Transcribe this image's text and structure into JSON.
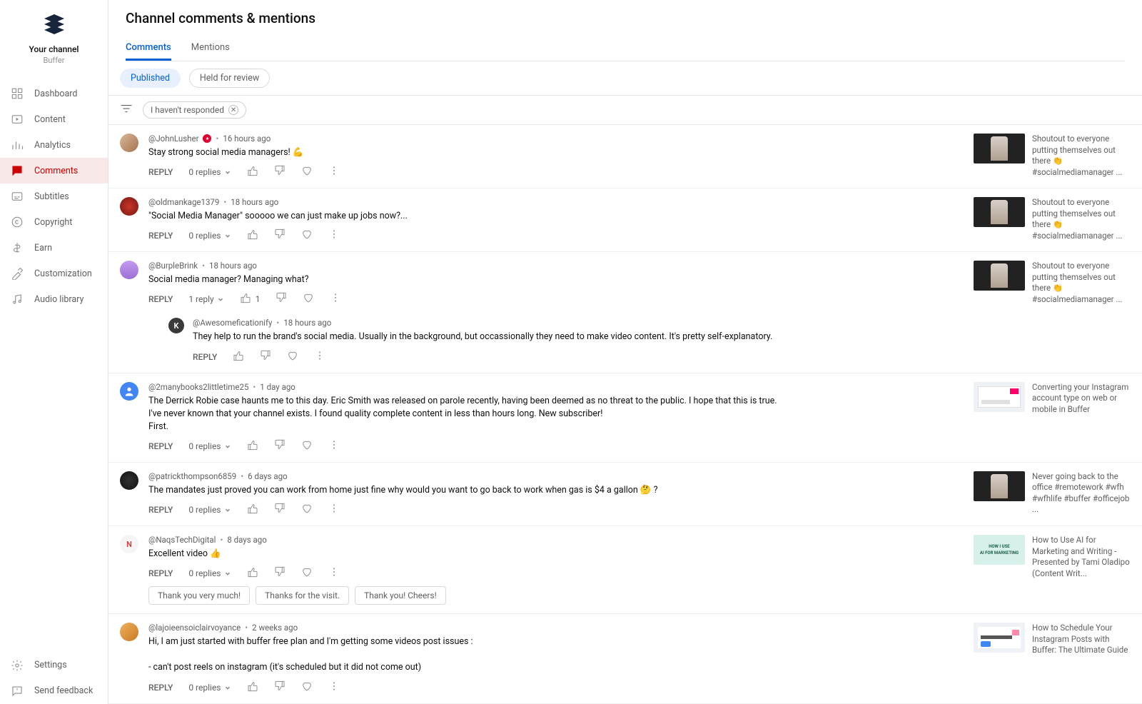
{
  "sidebar": {
    "channel_name": "Your channel",
    "channel_sub": "Buffer",
    "items": [
      {
        "label": "Dashboard",
        "icon": "dashboard"
      },
      {
        "label": "Content",
        "icon": "content"
      },
      {
        "label": "Analytics",
        "icon": "analytics"
      },
      {
        "label": "Comments",
        "icon": "comments",
        "active": true
      },
      {
        "label": "Subtitles",
        "icon": "subtitles"
      },
      {
        "label": "Copyright",
        "icon": "copyright"
      },
      {
        "label": "Earn",
        "icon": "earn"
      },
      {
        "label": "Customization",
        "icon": "customization"
      },
      {
        "label": "Audio library",
        "icon": "audio"
      }
    ],
    "footer": [
      {
        "label": "Settings",
        "icon": "settings"
      },
      {
        "label": "Send feedback",
        "icon": "feedback"
      }
    ]
  },
  "header": {
    "title": "Channel comments & mentions",
    "tabs": [
      {
        "label": "Comments",
        "active": true
      },
      {
        "label": "Mentions"
      }
    ],
    "subfilters": [
      {
        "label": "Published",
        "active": true
      },
      {
        "label": "Held for review"
      }
    ],
    "chip": "I haven't responded"
  },
  "comments": [
    {
      "user": "@JohnLusher",
      "badge": true,
      "time": "16 hours ago",
      "text": "Stay strong social media managers! 💪",
      "reply_label": "REPLY",
      "replies_text": "0 replies",
      "avatar_bg": "linear-gradient(135deg,#d8b89a,#a7734f)",
      "video": {
        "title": "Shoutout to everyone putting themselves out there 👏 #socialmediamanager ...",
        "thumb": "dark-person"
      }
    },
    {
      "user": "@oldmankage1379",
      "time": "18 hours ago",
      "text": "\"Social Media Manager\" sooooo we can just make up jobs now?...",
      "reply_label": "REPLY",
      "replies_text": "0 replies",
      "avatar_bg": "radial-gradient(#c73628,#7a1712)",
      "video": {
        "title": "Shoutout to everyone putting themselves out there 👏 #socialmediamanager ...",
        "thumb": "dark-person"
      }
    },
    {
      "user": "@BurpleBrink",
      "time": "18 hours ago",
      "text": "Social media manager? Managing what?",
      "reply_label": "REPLY",
      "replies_text": "1 reply",
      "like_count": "1",
      "avatar_bg": "linear-gradient(180deg,#c59bf0,#9b6fd6)",
      "video": {
        "title": "Shoutout to everyone putting themselves out there 👏 #socialmediamanager ...",
        "thumb": "dark-person"
      },
      "nested": {
        "user": "@Awesomeficationify",
        "time": "18 hours ago",
        "text": "They help to run the brand's social media. Usually in the background, but occassionally they need to make video content. It's pretty self-explanatory.",
        "reply_label": "REPLY",
        "avatar_bg": "#3a3a3a",
        "avatar_letter": "K"
      }
    },
    {
      "user": "@2manybooks2littletime25",
      "time": "1 day ago",
      "text": "The Derrick Robie case haunts me to this day. Eric Smith was released on parole recently, having been deemed as no threat to the public. I hope that this is true. I've never known that your channel exists. I found quality complete content in less than hours long. New subscriber!\nFirst.",
      "reply_label": "REPLY",
      "replies_text": "0 replies",
      "avatar_bg": "#4285f4",
      "avatar_default": true,
      "video": {
        "title": "Converting your Instagram account type on web or mobile in Buffer",
        "thumb": "light-grid"
      }
    },
    {
      "user": "@patrickthompson6859",
      "time": "6 days ago",
      "text": "The mandates just proved you can work from home just fine why would you want to go back to work when gas is $4 a gallon 🤔 ?",
      "reply_label": "REPLY",
      "replies_text": "0 replies",
      "avatar_bg": "radial-gradient(#333,#111)",
      "video": {
        "title": "Never going back to the office #remotework #wfh #wfhlife #buffer #officejob ...",
        "thumb": "dark-person"
      }
    },
    {
      "user": "@NaqsTechDigital",
      "time": "8 days ago",
      "text": "Excellent video 👍",
      "reply_label": "REPLY",
      "replies_text": "0 replies",
      "avatar_bg": "#f5f5f5",
      "avatar_letter": "N",
      "video": {
        "title": "How to Use AI for Marketing and Writing - Presented by Tami Oladipo (Content Writ...",
        "thumb": "light-teal"
      },
      "quick_replies": [
        "Thank you very much!",
        "Thanks for the visit.",
        "Thank you! Cheers!"
      ]
    },
    {
      "user": "@lajoieensoiclairvoyance",
      "time": "2 weeks ago",
      "text": "Hi, I am just started with buffer free plan and I'm getting some videos post issues :\n\n- can't post reels on instagram (it's scheduled but it did not come out)",
      "reply_label": "REPLY",
      "replies_text": "0 replies",
      "avatar_bg": "linear-gradient(135deg,#f0b060,#c77a20)",
      "video": {
        "title": "How to Schedule Your Instagram Posts with Buffer: The Ultimate Guide",
        "thumb": "light-pink"
      }
    }
  ]
}
